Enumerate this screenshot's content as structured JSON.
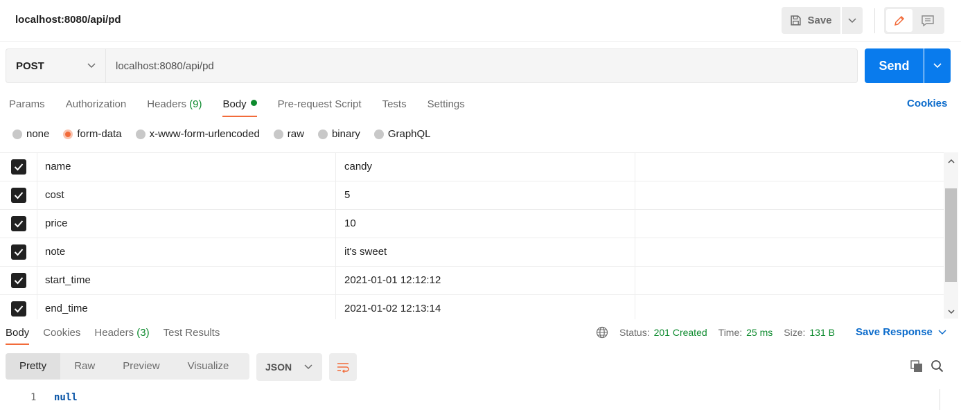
{
  "header": {
    "title": "localhost:8080/api/pd",
    "save_label": "Save"
  },
  "request": {
    "method": "POST",
    "url": "localhost:8080/api/pd",
    "send_label": "Send"
  },
  "tabs": [
    {
      "label": "Params",
      "count": ""
    },
    {
      "label": "Authorization",
      "count": ""
    },
    {
      "label": "Headers",
      "count": "(9)"
    },
    {
      "label": "Body",
      "count": ""
    },
    {
      "label": "Pre-request Script",
      "count": ""
    },
    {
      "label": "Tests",
      "count": ""
    },
    {
      "label": "Settings",
      "count": ""
    }
  ],
  "cookies_link": "Cookies",
  "body_types": [
    "none",
    "form-data",
    "x-www-form-urlencoded",
    "raw",
    "binary",
    "GraphQL"
  ],
  "selected_body_type": "form-data",
  "form_rows": [
    {
      "key": "name",
      "value": "candy",
      "checked": true
    },
    {
      "key": "cost",
      "value": "5",
      "checked": true
    },
    {
      "key": "price",
      "value": "10",
      "checked": true
    },
    {
      "key": "note",
      "value": "it's sweet",
      "checked": true
    },
    {
      "key": "start_time",
      "value": "2021-01-01 12:12:12",
      "checked": true
    },
    {
      "key": "end_time",
      "value": "2021-01-02 12:13:14",
      "checked": true
    }
  ],
  "response": {
    "tabs": [
      {
        "label": "Body",
        "count": ""
      },
      {
        "label": "Cookies",
        "count": ""
      },
      {
        "label": "Headers",
        "count": "(3)"
      },
      {
        "label": "Test Results",
        "count": ""
      }
    ],
    "status_label": "Status:",
    "status_value": "201 Created",
    "time_label": "Time:",
    "time_value": "25 ms",
    "size_label": "Size:",
    "size_value": "131 B",
    "save_response": "Save Response",
    "views": [
      "Pretty",
      "Raw",
      "Preview",
      "Visualize"
    ],
    "format": "JSON",
    "line_number": "1",
    "code": "null"
  },
  "colors": {
    "accent": "#f26b3a",
    "send": "#097bed",
    "link": "#0b6bcb",
    "success": "#0c8a2d"
  }
}
